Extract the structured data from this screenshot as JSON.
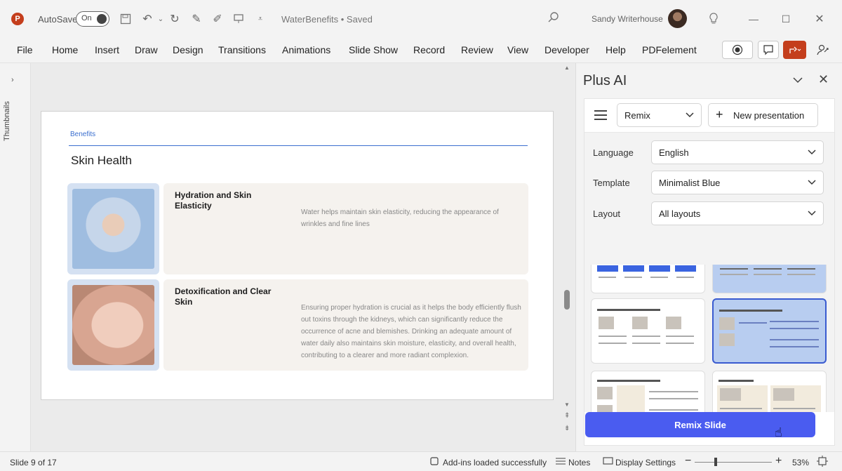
{
  "titlebar": {
    "app_logo": "P",
    "autosave_label": "AutoSave",
    "autosave_state": "On",
    "document_title": "WaterBenefits • Saved",
    "user_name": "Sandy Writerhouse",
    "icons": [
      "save-icon",
      "undo-icon",
      "redo-icon",
      "pen-icon",
      "present-icon",
      "more-icon",
      "search-icon",
      "lightbulb-icon"
    ]
  },
  "menu": {
    "items": [
      "File",
      "Home",
      "Insert",
      "Draw",
      "Design",
      "Transitions",
      "Animations",
      "Slide Show",
      "Record",
      "Review",
      "View",
      "Developer",
      "Help",
      "PDFelement"
    ]
  },
  "thumbnails": {
    "label": "Thumbnails",
    "expand_glyph": "›"
  },
  "slide": {
    "eyebrow": "Benefits",
    "title": "Skin Health",
    "cards": [
      {
        "heading": "Hydration and Skin Elasticity",
        "text": "Water helps maintain skin elasticity, reducing the appearance of wrinkles and fine lines"
      },
      {
        "heading": "Detoxification and Clear Skin",
        "text": "Ensuring proper hydration is crucial as it helps the body efficiently flush out toxins through the kidneys, which can significantly reduce the occurrence of acne and blemishes. Drinking an adequate amount of water daily also maintains skin moisture, elasticity, and overall health, contributing to a clearer and more radiant complexion."
      }
    ]
  },
  "panel": {
    "title": "Plus AI",
    "remix_select": "Remix",
    "new_presentation": "New presentation",
    "language_label": "Language",
    "language_value": "English",
    "template_label": "Template",
    "template_value": "Minimalist Blue",
    "layout_label": "Layout",
    "layout_value": "All layouts",
    "remix_button": "Remix Slide"
  },
  "status": {
    "slide_counter": "Slide 9 of 17",
    "addins": "Add-ins loaded successfully",
    "notes": "Notes",
    "display_settings": "Display Settings",
    "zoom": "53%"
  }
}
